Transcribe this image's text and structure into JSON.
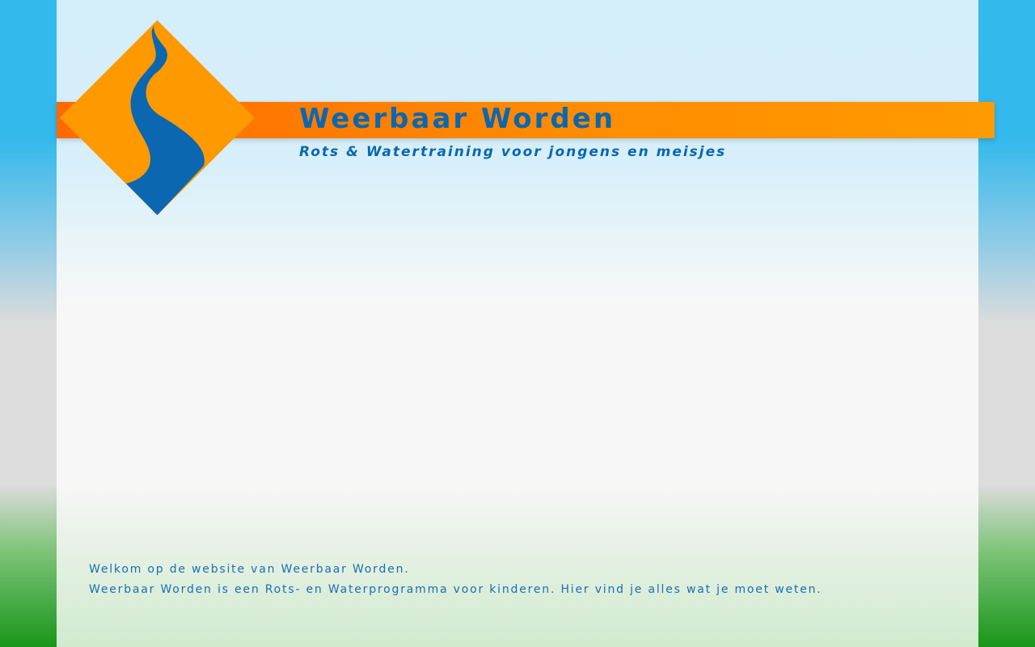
{
  "header": {
    "title": "Weerbaar Worden",
    "subtitle": "Rots & Watertraining voor jongens en meisjes",
    "logo_icon": "diamond-river-logo-icon"
  },
  "intro": {
    "line1": "Welkom op de website van Weerbaar Worden.",
    "line2": "Weerbaar Worden is een Rots- en Waterprogramma voor kinderen. Hier vind je alles wat je moet weten."
  },
  "colors": {
    "accent_orange": "#ff8c00",
    "logo_orange": "#ff9900",
    "brand_blue": "#0a67b0",
    "side_sky_blue": "#33b9ec",
    "side_grass_green": "#18961a"
  }
}
